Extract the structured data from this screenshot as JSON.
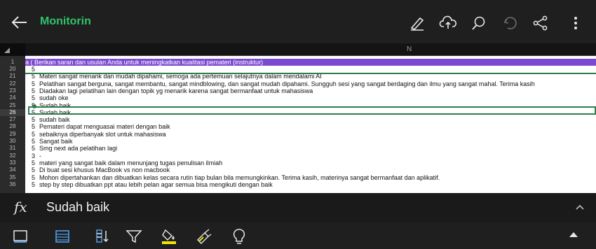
{
  "app": {
    "title": "Monitorin"
  },
  "sheet": {
    "column_label": "N",
    "header_row": {
      "row_num": "1",
      "text": "a ( Berikan saran dan usulan Anda untuk meningkatkan kualitasi pemateri (instruktur)"
    },
    "rows": [
      {
        "row_num": "20",
        "value": "5",
        "text": ""
      },
      {
        "row_num": "21",
        "value": "5",
        "text": "Materi sangat menarik dan mudah dipahami, semoga ada pertemuan selajutnya dalam mendalami AI"
      },
      {
        "row_num": "22",
        "value": "5",
        "text": "Pelatihan sangat berguna, sangat membantu, sangat mindblowing, dan sangat mudah dipahami. Sungguh sesi yang sangat berdaging dan ilmu yang sangat mahal. Terima kasih"
      },
      {
        "row_num": "23",
        "value": "5",
        "text": "Diadakan lagi pelatihan lain dengan topik yg menarik karena sangat bermanfaat untuk mahasiswa"
      },
      {
        "row_num": "24",
        "value": "5",
        "text": "sudah oke"
      },
      {
        "row_num": "25",
        "value": "5",
        "text": "Sudah baik"
      },
      {
        "row_num": "26",
        "value": "5",
        "text": "Sudah baik"
      },
      {
        "row_num": "27",
        "value": "5",
        "text": "sudah baik"
      },
      {
        "row_num": "28",
        "value": "5",
        "text": "Pemateri dapat menguasai materi dengan baik"
      },
      {
        "row_num": "29",
        "value": "5",
        "text": "sebaiknya diperbanyak slot untuk mahasiswa"
      },
      {
        "row_num": "30",
        "value": "5",
        "text": "Sangat baik"
      },
      {
        "row_num": "31",
        "value": "5",
        "text": "Smg next ada pelatihan lagi"
      },
      {
        "row_num": "32",
        "value": "3",
        "text": "-"
      },
      {
        "row_num": "33",
        "value": "5",
        "text": "materi yang sangat baik dalam menunjang tugas penulisan ilmiah"
      },
      {
        "row_num": "34",
        "value": "5",
        "text": "Di buat sesi khusus MacBook vs non macbook"
      },
      {
        "row_num": "35",
        "value": "5",
        "text": "Mohon dipertahankan dan dibuatkan kelas secara rutin tiap bulan bila memungkinkan. Terima kasih, materinya sangat bermanfaat dan aplikatif."
      },
      {
        "row_num": "36",
        "value": "5",
        "text": "step by step dibuatkan ppt atau lebih pelan agar semua bisa mengikuti dengan baik"
      }
    ]
  },
  "formula_bar": {
    "fx_label": "fx",
    "value": "Sudah baik"
  },
  "icons": {
    "back": "arrow-left-icon",
    "pen": "pen-draw-icon",
    "cloud": "cloud-upload-icon",
    "search": "search-icon",
    "undo": "undo-icon",
    "share": "share-icon",
    "more": "more-vertical-icon"
  },
  "colors": {
    "accent_green": "#2fc36b",
    "header_purple": "#7a4bd1",
    "selection_green": "#2e7d4f",
    "highlight_yellow": "#f2e600"
  }
}
